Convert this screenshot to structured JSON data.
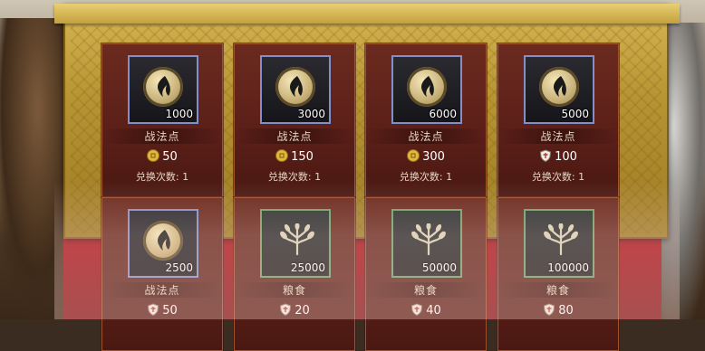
{
  "items": [
    {
      "name": "战法点",
      "quantity": "1000",
      "icon": "tactic-point-icon",
      "currency": "gold-coin-icon",
      "price": "50",
      "limit": "兑换次数: 1"
    },
    {
      "name": "战法点",
      "quantity": "3000",
      "icon": "tactic-point-icon",
      "currency": "gold-coin-icon",
      "price": "150",
      "limit": "兑换次数: 1"
    },
    {
      "name": "战法点",
      "quantity": "6000",
      "icon": "tactic-point-icon",
      "currency": "gold-coin-icon",
      "price": "300",
      "limit": "兑换次数: 1"
    },
    {
      "name": "战法点",
      "quantity": "5000",
      "icon": "tactic-point-icon",
      "currency": "shield-token-icon",
      "price": "100",
      "limit": "兑换次数: 1"
    },
    {
      "name": "战法点",
      "quantity": "2500",
      "icon": "tactic-point-icon",
      "currency": "shield-token-icon",
      "price": "50",
      "limit": ""
    },
    {
      "name": "粮食",
      "quantity": "25000",
      "icon": "grain-icon",
      "currency": "shield-token-icon",
      "price": "20",
      "limit": ""
    },
    {
      "name": "粮食",
      "quantity": "50000",
      "icon": "grain-icon",
      "currency": "shield-token-icon",
      "price": "40",
      "limit": ""
    },
    {
      "name": "粮食",
      "quantity": "100000",
      "icon": "grain-icon",
      "currency": "shield-token-icon",
      "price": "80",
      "limit": ""
    }
  ],
  "colors": {
    "cabinet_gold": "#c3a03c",
    "card_bg": "#5a1f18",
    "frame_blue": "#8390c8",
    "frame_green": "#6ea16a"
  }
}
